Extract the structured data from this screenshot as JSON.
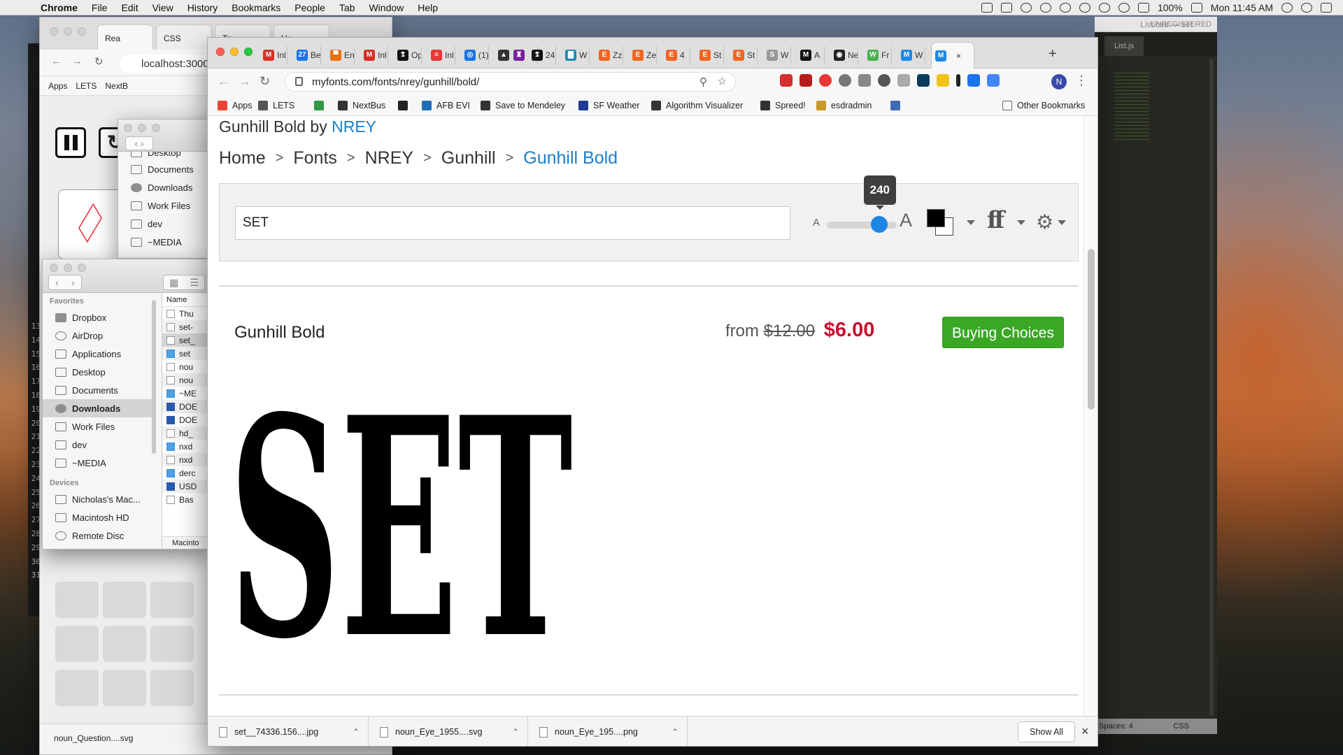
{
  "menubar": {
    "app": "Chrome",
    "items": [
      "File",
      "Edit",
      "View",
      "History",
      "Bookmarks",
      "People",
      "Tab",
      "Window",
      "Help"
    ],
    "battery": "100%",
    "clock": "Mon 11:45 AM"
  },
  "sublime": {
    "title": "List.css — set",
    "unregistered": "UNREGISTERED",
    "tab": "List.js",
    "status_left": "Spaces: 4",
    "status_right": "CSS"
  },
  "terminal": {
    "line_numbers": [
      "13",
      "14",
      "15",
      "16",
      "17",
      "18",
      "19",
      "20",
      "21",
      "22",
      "23",
      "24",
      "25",
      "26",
      "27",
      "28",
      "29",
      "30",
      "31"
    ]
  },
  "back_chrome": {
    "tabs": [
      "Rea",
      "CSS",
      "Try",
      "Ho"
    ],
    "url": "localhost:3000",
    "bookmarks": [
      "Apps",
      "LETS",
      "NextB"
    ],
    "download": "noun_Question....svg"
  },
  "finder_top": {
    "items": [
      "Desktop",
      "Documents",
      "Downloads",
      "Work Files",
      "dev",
      "~MEDIA"
    ]
  },
  "finder": {
    "favorites_header": "Favorites",
    "favorites": [
      "Dropbox",
      "AirDrop",
      "Applications",
      "Desktop",
      "Documents",
      "Downloads",
      "Work Files",
      "dev",
      "~MEDIA"
    ],
    "devices_header": "Devices",
    "devices": [
      "Nicholas's Mac...",
      "Macintosh HD",
      "Remote Disc"
    ],
    "column_header": "Name",
    "files": [
      "Thu",
      "set-",
      "set_",
      "set",
      "nou",
      "nou",
      "~ME",
      "DOE",
      "DOE",
      "hd_",
      "nxd",
      "nxd",
      "derc",
      "USD",
      "Bas"
    ],
    "path": "Macinto"
  },
  "main_chrome": {
    "tabs": [
      {
        "label": "Inl",
        "color": "#d93025",
        "glyph": "M"
      },
      {
        "label": "Be",
        "color": "#1a73e8",
        "glyph": "27"
      },
      {
        "label": "En",
        "color": "#e8710a",
        "glyph": "▀"
      },
      {
        "label": "Inl",
        "color": "#d93025",
        "glyph": "M"
      },
      {
        "label": "Op",
        "color": "#111111",
        "glyph": "𝕿"
      },
      {
        "label": "Inl",
        "color": "#e53935",
        "glyph": "≡"
      },
      {
        "label": "(1)",
        "color": "#1a73e8",
        "glyph": "◎"
      },
      {
        "label": "",
        "color": "#333333",
        "glyph": "▲"
      },
      {
        "label": "",
        "color": "#7b1fa2",
        "glyph": "♜"
      },
      {
        "label": "24",
        "color": "#111111",
        "glyph": "𝕿"
      },
      {
        "label": "W",
        "color": "#1e88b5",
        "glyph": "▇"
      },
      {
        "label": "Zz",
        "color": "#f16521",
        "glyph": "E"
      },
      {
        "label": "Ze",
        "color": "#f16521",
        "glyph": "E"
      },
      {
        "label": "4",
        "color": "#f16521",
        "glyph": "E"
      },
      {
        "label": "St",
        "color": "#f16521",
        "glyph": "E"
      },
      {
        "label": "St",
        "color": "#f16521",
        "glyph": "E"
      },
      {
        "label": "W",
        "color": "#999999",
        "glyph": "S"
      },
      {
        "label": "A",
        "color": "#111111",
        "glyph": "M"
      },
      {
        "label": "Ne",
        "color": "#222222",
        "glyph": "◉"
      },
      {
        "label": "Fr",
        "color": "#4caf50",
        "glyph": "W"
      },
      {
        "label": "W",
        "color": "#1e88e5",
        "glyph": "M"
      },
      {
        "label": "",
        "color": "#1e88e5",
        "glyph": "M"
      }
    ],
    "active_close": "×",
    "new_tab": "+",
    "url": "myfonts.com/fonts/nrey/gunhill/bold/",
    "bookmarks": [
      {
        "label": "Apps",
        "color": "#ea4335"
      },
      {
        "label": "LETS",
        "color": "#555555"
      },
      {
        "label": "",
        "color": "#2e9a46"
      },
      {
        "label": "NextBus",
        "color": "#333333"
      },
      {
        "label": "",
        "color": "#222222"
      },
      {
        "label": "AFB EVI",
        "color": "#1e6fb8"
      },
      {
        "label": "Save to Mendeley",
        "color": "#333333"
      },
      {
        "label": "SF Weather",
        "color": "#1f3a93"
      },
      {
        "label": "Algorithm Visualizer",
        "color": "#333333"
      },
      {
        "label": "Spreed!",
        "color": "#333333"
      },
      {
        "label": "esdradmin",
        "color": "#c59a2a"
      },
      {
        "label": "",
        "color": "#3f6db5"
      }
    ],
    "other_bookmarks": "Other Bookmarks",
    "profile": "N"
  },
  "page": {
    "title_prefix": "Gunhill Bold by ",
    "title_link": "NREY",
    "breadcrumbs": [
      "Home",
      "Fonts",
      "NREY",
      "Gunhill"
    ],
    "breadcrumb_current": "Gunhill Bold",
    "breadcrumb_sep": ">",
    "test_text": "SET",
    "size_small": "A",
    "size_big": "A",
    "size_value": "240",
    "size_level": 0.9,
    "text_color": "#000000",
    "bg_color": "#ffffff",
    "font_name": "Gunhill Bold",
    "price_from": "from",
    "price_original": "$12.00",
    "price_sale": "$6.00",
    "buy_label": "Buying Choices",
    "sample_text": "SET"
  },
  "downloads": {
    "items": [
      "set__74336.156....jpg",
      "noun_Eye_1955....svg",
      "noun_Eye_195....png"
    ],
    "show_all": "Show All",
    "close": "×"
  }
}
